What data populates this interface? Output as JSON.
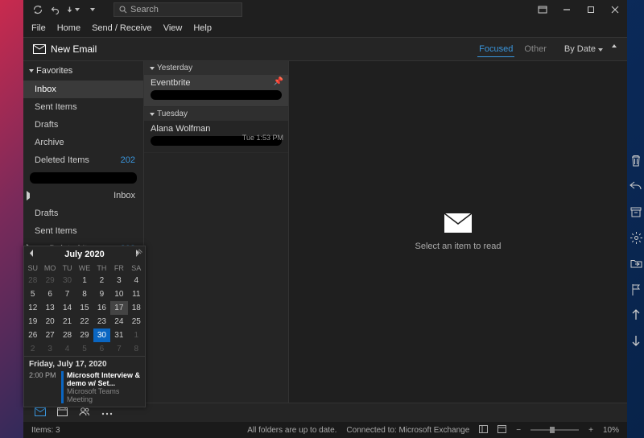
{
  "titlebar": {
    "search_placeholder": "Search"
  },
  "menu": [
    "File",
    "Home",
    "Send / Receive",
    "View",
    "Help"
  ],
  "toolbar": {
    "new_email": "New Email"
  },
  "msgtabs": {
    "focused": "Focused",
    "other": "Other",
    "sort": "By Date"
  },
  "sidebar": {
    "favorites_label": "Favorites",
    "items": [
      {
        "label": "Inbox",
        "count": "",
        "selected": true
      },
      {
        "label": "Sent Items",
        "count": ""
      },
      {
        "label": "Drafts",
        "count": ""
      },
      {
        "label": "Archive",
        "count": ""
      },
      {
        "label": "Deleted Items",
        "count": "202"
      }
    ],
    "account_items": [
      {
        "label": "Inbox",
        "exp": true
      },
      {
        "label": "Drafts"
      },
      {
        "label": "Sent Items"
      },
      {
        "label": "Deleted Items",
        "count": "202",
        "exp": true
      }
    ]
  },
  "groups": [
    {
      "label": "Yesterday",
      "messages": [
        {
          "sender": "Eventbrite",
          "time": "",
          "pinned": true,
          "selected": true
        }
      ]
    },
    {
      "label": "Tuesday",
      "messages": [
        {
          "sender": "Alana Wolfman",
          "time": "Tue 1:53 PM"
        }
      ]
    }
  ],
  "reading": {
    "placeholder": "Select an item to read"
  },
  "calendar": {
    "title": "July 2020",
    "dow": [
      "SU",
      "MO",
      "TU",
      "WE",
      "TH",
      "FR",
      "SA"
    ],
    "days": [
      {
        "n": "28",
        "dim": true
      },
      {
        "n": "29",
        "dim": true
      },
      {
        "n": "30",
        "dim": true
      },
      {
        "n": "1"
      },
      {
        "n": "2"
      },
      {
        "n": "3"
      },
      {
        "n": "4"
      },
      {
        "n": "5"
      },
      {
        "n": "6"
      },
      {
        "n": "7"
      },
      {
        "n": "8"
      },
      {
        "n": "9"
      },
      {
        "n": "10"
      },
      {
        "n": "11"
      },
      {
        "n": "12"
      },
      {
        "n": "13"
      },
      {
        "n": "14"
      },
      {
        "n": "15"
      },
      {
        "n": "16"
      },
      {
        "n": "17",
        "today": true
      },
      {
        "n": "18"
      },
      {
        "n": "19"
      },
      {
        "n": "20"
      },
      {
        "n": "21"
      },
      {
        "n": "22"
      },
      {
        "n": "23"
      },
      {
        "n": "24"
      },
      {
        "n": "25"
      },
      {
        "n": "26"
      },
      {
        "n": "27"
      },
      {
        "n": "28"
      },
      {
        "n": "29"
      },
      {
        "n": "30",
        "sel": true
      },
      {
        "n": "31"
      },
      {
        "n": "1",
        "dim": true
      },
      {
        "n": "2",
        "dim": true
      },
      {
        "n": "3",
        "dim": true
      },
      {
        "n": "4",
        "dim": true
      },
      {
        "n": "5",
        "dim": true
      },
      {
        "n": "6",
        "dim": true
      },
      {
        "n": "7",
        "dim": true
      },
      {
        "n": "8",
        "dim": true
      }
    ],
    "agenda_date": "Friday, July 17, 2020",
    "agenda_time": "2:00 PM",
    "agenda_title": "Microsoft Interview & demo w/ Set...",
    "agenda_sub": "Microsoft Teams Meeting"
  },
  "status": {
    "items": "Items: 3",
    "folders": "All folders are up to date.",
    "connected": "Connected to: Microsoft Exchange",
    "zoom": "10%"
  }
}
